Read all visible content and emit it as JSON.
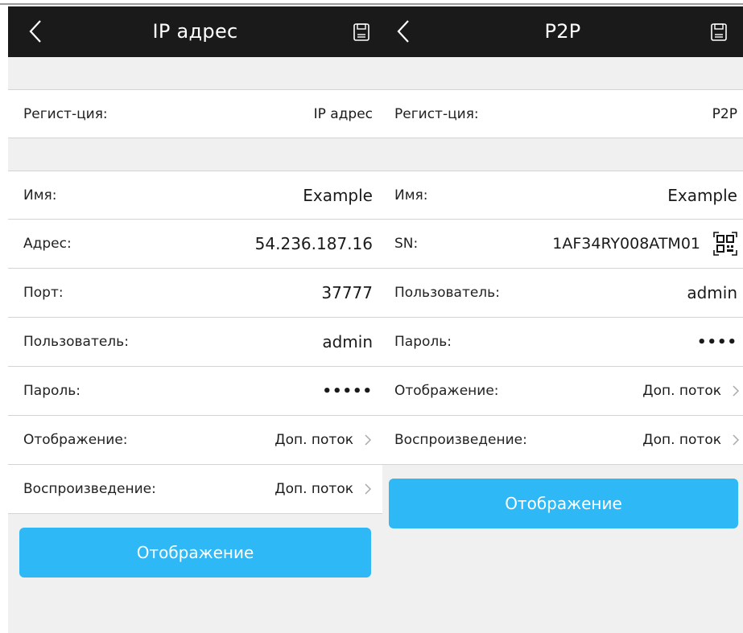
{
  "left": {
    "header": {
      "title": "IP адрес"
    },
    "registration": {
      "label": "Регист-ция:",
      "value": "IP адрес"
    },
    "fields": [
      {
        "label": "Имя:",
        "value": "Example"
      },
      {
        "label": "Адрес:",
        "value": "54.236.187.16"
      },
      {
        "label": "Порт:",
        "value": "37777"
      },
      {
        "label": "Пользователь:",
        "value": "admin"
      },
      {
        "label": "Пароль:",
        "value": "•••••"
      },
      {
        "label": "Отображение:",
        "value": "Доп. поток"
      },
      {
        "label": "Воспроизведение:",
        "value": "Доп. поток"
      }
    ],
    "button_label": "Отображение"
  },
  "right": {
    "header": {
      "title": "P2P"
    },
    "registration": {
      "label": "Регист-ция:",
      "value": "P2P"
    },
    "fields": [
      {
        "label": "Имя:",
        "value": "Example"
      },
      {
        "label": "SN:",
        "value": "1AF34RY008ATM01"
      },
      {
        "label": "Пользователь:",
        "value": "admin"
      },
      {
        "label": "Пароль:",
        "value": "••••"
      },
      {
        "label": "Отображение:",
        "value": "Доп. поток"
      },
      {
        "label": "Воспроизведение:",
        "value": "Доп. поток"
      }
    ],
    "button_label": "Отображение"
  },
  "colors": {
    "header_bg": "#1a1a1a",
    "button_bg": "#2eb8f5",
    "panel_bg": "#f0f0f0"
  },
  "icons": [
    "back-arrow-icon",
    "save-icon",
    "chevron-right-icon",
    "qr-scan-icon"
  ]
}
